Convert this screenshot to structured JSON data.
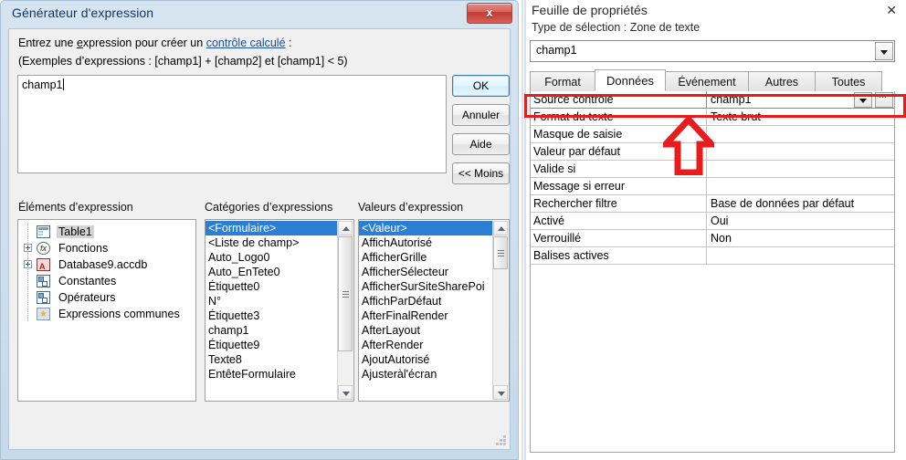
{
  "dialog": {
    "title": "Générateur d'expression",
    "close_label": "x",
    "instruction_prefix": "Entrez une ",
    "instruction_accesskey": "e",
    "instruction_mid": "xpression pour créer un ",
    "instruction_link": "contrôle calculé",
    "instruction_suffix": " :",
    "examples": "(Exemples d’expressions : [champ1] + [champ2] et [champ1] < 5)",
    "expression_value": "champ1",
    "buttons": {
      "ok": "OK",
      "cancel": "Annuler",
      "help": "Aide",
      "less": "<< Moins"
    },
    "columns": {
      "elements_label": "Éléments d’expression",
      "categories_label": "Catégories d’expressions",
      "values_label": "Valeurs d’expression"
    },
    "elements_tree": [
      {
        "label": "Table1",
        "icon": "table-icon",
        "expandable": false,
        "selected": true
      },
      {
        "label": "Fonctions",
        "icon": "function-icon",
        "expandable": true,
        "selected": false
      },
      {
        "label": "Database9.accdb",
        "icon": "database-icon",
        "expandable": true,
        "selected": false
      },
      {
        "label": "Constantes",
        "icon": "constants-icon",
        "expandable": false,
        "selected": false
      },
      {
        "label": "Opérateurs",
        "icon": "operators-icon",
        "expandable": false,
        "selected": false
      },
      {
        "label": "Expressions communes",
        "icon": "common-expressions-icon",
        "expandable": false,
        "selected": false
      }
    ],
    "categories_list": [
      {
        "label": "<Formulaire>",
        "selected": true
      },
      {
        "label": "<Liste de champ>",
        "selected": false
      },
      {
        "label": "Auto_Logo0",
        "selected": false
      },
      {
        "label": "Auto_EnTete0",
        "selected": false
      },
      {
        "label": "Étiquette0",
        "selected": false
      },
      {
        "label": "N°",
        "selected": false
      },
      {
        "label": "Étiquette3",
        "selected": false
      },
      {
        "label": "champ1",
        "selected": false
      },
      {
        "label": "Étiquette9",
        "selected": false
      },
      {
        "label": "Texte8",
        "selected": false
      },
      {
        "label": "EntêteFormulaire",
        "selected": false
      }
    ],
    "values_list": [
      {
        "label": "<Valeur>",
        "selected": true
      },
      {
        "label": "AffichAutorisé",
        "selected": false
      },
      {
        "label": "AfficherGrille",
        "selected": false
      },
      {
        "label": "AfficherSélecteur",
        "selected": false
      },
      {
        "label": "AfficherSurSiteSharePoi",
        "selected": false
      },
      {
        "label": "AffichParDéfaut",
        "selected": false
      },
      {
        "label": "AfterFinalRender",
        "selected": false
      },
      {
        "label": "AfterLayout",
        "selected": false
      },
      {
        "label": "AfterRender",
        "selected": false
      },
      {
        "label": "AjoutAutorisé",
        "selected": false
      },
      {
        "label": "Ajusteràl'écran",
        "selected": false
      }
    ]
  },
  "property_sheet": {
    "title": "Feuille de propriétés",
    "close_label": "✕",
    "selection_type": "Type de sélection :  Zone de texte",
    "selected_object": "champ1",
    "tabs": [
      {
        "label": "Format",
        "active": false
      },
      {
        "label": "Données",
        "active": true
      },
      {
        "label": "Événement",
        "active": false
      },
      {
        "label": "Autres",
        "active": false
      },
      {
        "label": "Toutes",
        "active": false
      }
    ],
    "properties": [
      {
        "name": "Source contrôle",
        "value": "champ1",
        "active": true
      },
      {
        "name": "Format du texte",
        "value": "Texte brut",
        "active": false
      },
      {
        "name": "Masque de saisie",
        "value": "",
        "active": false
      },
      {
        "name": "Valeur par défaut",
        "value": "",
        "active": false
      },
      {
        "name": "Valide si",
        "value": "",
        "active": false
      },
      {
        "name": "Message si erreur",
        "value": "",
        "active": false
      },
      {
        "name": "Rechercher filtre",
        "value": "Base de données par défaut",
        "active": false
      },
      {
        "name": "Activé",
        "value": "Oui",
        "active": false
      },
      {
        "name": "Verrouillé",
        "value": "Non",
        "active": false
      },
      {
        "name": "Balises actives",
        "value": "",
        "active": false
      }
    ]
  },
  "annotations": {
    "highlight_color": "#e81c1c",
    "arrow_color": "#e81c1c"
  }
}
